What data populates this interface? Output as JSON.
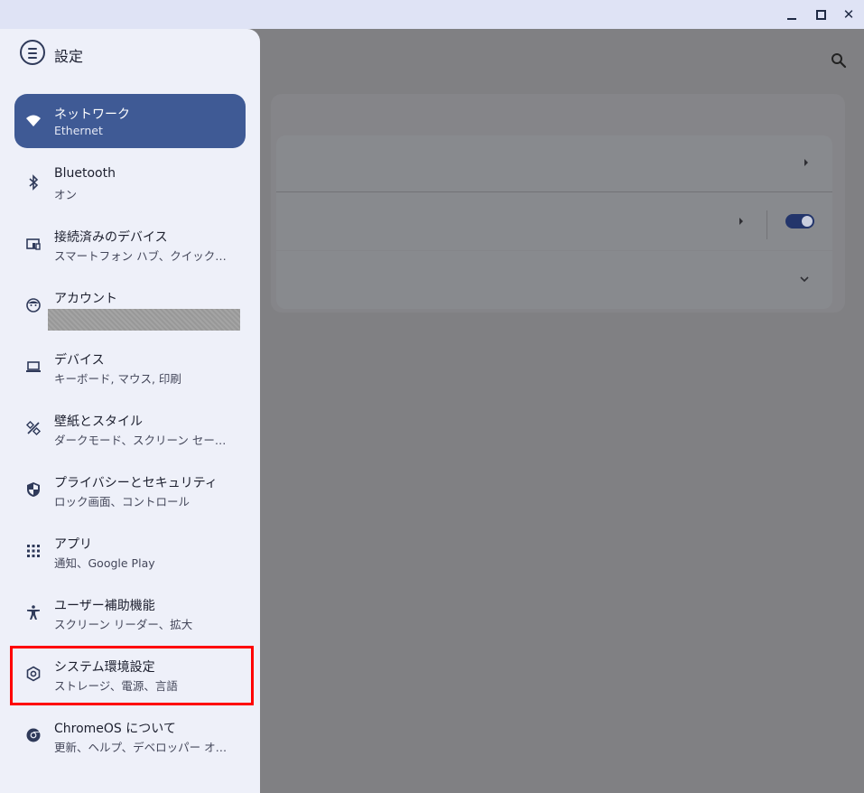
{
  "window": {
    "controls": [
      "minimize",
      "maximize",
      "close"
    ],
    "close_glyph": "✕"
  },
  "drawer": {
    "title": "設定",
    "menu_icon": "hamburger-menu-icon",
    "items": [
      {
        "label": "ネットワーク",
        "sub": "Ethernet",
        "icon": "wifi-icon",
        "active": true
      },
      {
        "label": "Bluetooth",
        "sub": "オン",
        "icon": "bluetooth-icon"
      },
      {
        "label": "接続済みのデバイス",
        "sub": "スマートフォン ハブ、クイック…",
        "icon": "connected-devices-icon"
      },
      {
        "label": "アカウント",
        "sub": "",
        "icon": "account-face-icon",
        "redacted": true
      },
      {
        "label": "デバイス",
        "sub": "キーボード, マウス, 印刷",
        "icon": "laptop-icon"
      },
      {
        "label": "壁紙とスタイル",
        "sub": "ダークモード、スクリーン セー…",
        "icon": "palette-icon"
      },
      {
        "label": "プライバシーとセキュリティ",
        "sub": "ロック画面、コントロール",
        "icon": "shield-icon"
      },
      {
        "label": "アプリ",
        "sub": "通知、Google Play",
        "icon": "apps-grid-icon"
      },
      {
        "label": "ユーザー補助機能",
        "sub": "スクリーン リーダー、拡大",
        "icon": "accessibility-icon"
      },
      {
        "label": "システム環境設定",
        "sub": "ストレージ、電源、言語",
        "icon": "settings-gear-icon",
        "highlighted": true
      },
      {
        "label": "ChromeOS について",
        "sub": "更新、ヘルプ、デベロッパー オ…",
        "icon": "chrome-icon"
      }
    ]
  },
  "colors": {
    "accent": "#3f5a95",
    "drawer_bg": "#eef0f9",
    "titlebar_bg": "#dfe3f5",
    "scrim": "#7f7f82",
    "highlight": "#ff0000"
  },
  "main": {
    "search_icon": "search-icon",
    "toggle_on": true
  }
}
